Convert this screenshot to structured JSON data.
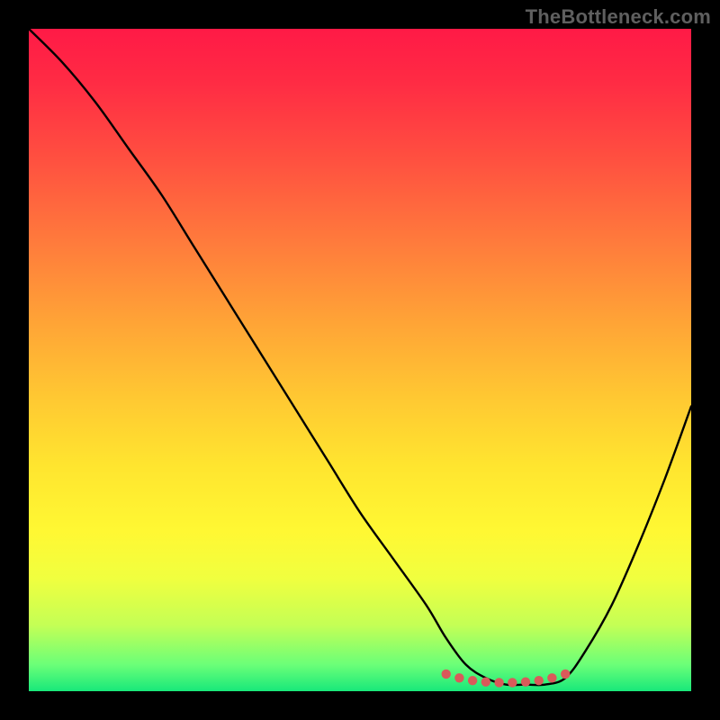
{
  "watermark": "TheBottleneck.com",
  "colors": {
    "page_bg": "#000000",
    "curve": "#000000",
    "dots": "#d95a5a",
    "gradient_stops": [
      "#ff1a46",
      "#ff2b44",
      "#ff5140",
      "#ff7a3c",
      "#ffa636",
      "#ffc932",
      "#ffe52f",
      "#fff833",
      "#f0ff3f",
      "#c4ff55",
      "#6bff78",
      "#18e87a"
    ]
  },
  "chart_data": {
    "type": "line",
    "title": "",
    "xlabel": "",
    "ylabel": "",
    "xlim": [
      0,
      100
    ],
    "ylim": [
      0,
      100
    ],
    "x": [
      0,
      5,
      10,
      15,
      20,
      25,
      30,
      35,
      40,
      45,
      50,
      55,
      60,
      63,
      66,
      69,
      72,
      75,
      78,
      81,
      84,
      88,
      92,
      96,
      100
    ],
    "y": [
      100,
      95,
      89,
      82,
      75,
      67,
      59,
      51,
      43,
      35,
      27,
      20,
      13,
      8,
      4,
      2,
      1,
      1,
      1,
      2,
      6,
      13,
      22,
      32,
      43
    ],
    "annotations": {
      "highlight_dots_x": [
        63,
        65,
        67,
        69,
        71,
        73,
        75,
        77,
        79,
        81
      ],
      "highlight_dots_y": [
        2.6,
        2.0,
        1.6,
        1.4,
        1.3,
        1.3,
        1.4,
        1.6,
        2.0,
        2.6
      ]
    }
  }
}
